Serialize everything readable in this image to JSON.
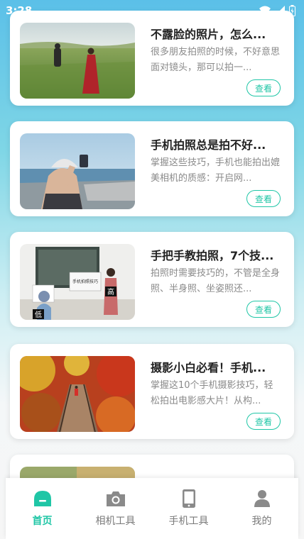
{
  "status_bar": {
    "time": "3:28"
  },
  "colors": {
    "accent": "#1fc6a6",
    "sky_top": "#5bc0e8",
    "card_bg": "#ffffff"
  },
  "articles": [
    {
      "title": "不露脸的照片，怎么...",
      "desc": "很多朋友拍照的时候，不好意思面对镜头，那可以拍一...",
      "button": "查看"
    },
    {
      "title": "手机拍照总是拍不好...",
      "desc": "掌握这些技巧，手机也能拍出媲美相机的质感：开启网...",
      "button": "查看"
    },
    {
      "title": "手把手教拍照，7个技...",
      "desc": "拍照时需要技巧的，不管是全身照、半身照、坐姿照还...",
      "button": "查看"
    },
    {
      "title": "摄影小白必看！手机...",
      "desc": "掌握这10个手机摄影技巧，轻松拍出电影感大片！从构...",
      "button": "查看"
    }
  ],
  "thumb_labels": {
    "low": "低",
    "high": "高",
    "poster": "手机拍照技巧"
  },
  "tabs": [
    {
      "label": "首页",
      "icon": "home-icon"
    },
    {
      "label": "相机工具",
      "icon": "camera-icon"
    },
    {
      "label": "手机工具",
      "icon": "phone-icon"
    },
    {
      "label": "我的",
      "icon": "user-icon"
    }
  ]
}
